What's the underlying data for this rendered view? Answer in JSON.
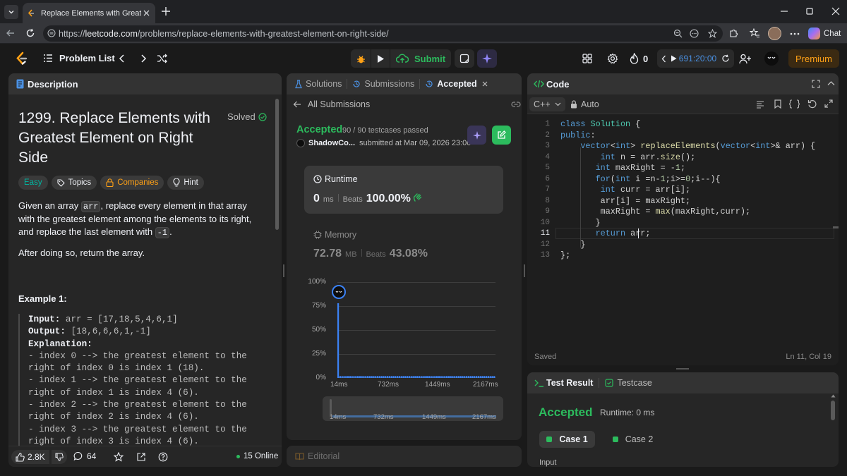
{
  "browser": {
    "tab_title": "Replace Elements with Greatest Ele",
    "url_prefix": "https://",
    "url_host": "leetcode.com",
    "url_path": "/problems/replace-elements-with-greatest-element-on-right-side/",
    "chat_label": "Chat"
  },
  "nav": {
    "problem_list": "Problem List",
    "submit": "Submit",
    "streak": "0",
    "timer": "691:20:00",
    "premium": "Premium"
  },
  "description": {
    "tab": "Description",
    "title": "1299. Replace Elements with Greatest Element on Right Side",
    "solved": "Solved",
    "tags": {
      "easy": "Easy",
      "topics": "Topics",
      "companies": "Companies",
      "hint": "Hint"
    },
    "p1_a": "Given an array ",
    "p1_code1": "arr",
    "p1_b": ", replace every element in that array with the greatest element among the elements to its right, and replace the last element with ",
    "p1_code2": "-1",
    "p1_c": ".",
    "p2": "After doing so, return the array.",
    "example_title": "Example 1:",
    "input_label": "Input:",
    "input_value": "arr = [17,18,5,4,6,1]",
    "output_label": "Output:",
    "output_value": "[18,6,6,6,1,-1]",
    "explanation_label": "Explanation:",
    "explanation_lines": [
      "- index 0 --> the greatest element to the",
      "right of index 0 is index 1 (18).",
      "- index 1 --> the greatest element to the",
      "right of index 1 is index 4 (6).",
      "- index 2 --> the greatest element to the",
      "right of index 2 is index 4 (6).",
      "- index 3 --> the greatest element to the",
      "right of index 3 is index 4 (6)."
    ],
    "likes": "2.8K",
    "comments": "64",
    "online": "15 Online"
  },
  "submission": {
    "tabs": {
      "solutions": "Solutions",
      "submissions": "Submissions",
      "accepted": "Accepted"
    },
    "back": "All Submissions",
    "status": "Accepted",
    "testcases": "90 / 90 testcases passed",
    "user": "ShadowCo...",
    "submitted_at": "submitted at Mar 09, 2026 23:00",
    "runtime_label": "Runtime",
    "runtime_value": "0",
    "runtime_unit": "ms",
    "beats_label": "Beats",
    "runtime_beats": "100.00%",
    "memory_label": "Memory",
    "memory_value": "72.78",
    "memory_unit": "MB",
    "memory_beats": "43.08%",
    "editorial": "Editorial"
  },
  "chart_data": {
    "type": "bar",
    "yticks": [
      "100%",
      "75%",
      "50%",
      "25%",
      "0%"
    ],
    "xticks": [
      "14ms",
      "732ms",
      "1449ms",
      "2167ms"
    ],
    "ylim": [
      0,
      100
    ],
    "values": [
      78,
      2,
      2,
      2,
      2,
      2,
      2,
      2,
      2,
      2,
      2,
      2,
      2,
      2,
      2,
      2,
      2,
      2,
      2,
      2,
      2,
      2,
      2,
      2,
      2,
      2,
      2,
      2,
      2,
      2,
      2,
      2,
      2,
      2,
      2,
      2,
      2,
      2,
      2,
      2,
      2,
      2,
      2,
      2,
      2,
      2,
      2,
      2,
      2,
      2,
      2,
      2,
      2,
      2,
      2,
      2,
      2,
      2,
      2,
      2,
      2,
      2,
      2,
      2,
      2,
      2,
      2,
      2,
      2,
      2,
      2,
      2,
      2,
      2,
      2,
      2,
      2,
      2,
      2,
      2
    ],
    "bar_color": "#3b82f6",
    "grid": true
  },
  "code": {
    "tab": "Code",
    "language": "C++",
    "mode": "Auto",
    "lines": [
      "class Solution {",
      "public:",
      "    vector<int> replaceElements(vector<int>& arr) {",
      "        int n = arr.size();",
      "       int maxRight = -1;",
      "       for(int i =n-1;i>=0;i--){",
      "        int curr = arr[i];",
      "        arr[i] = maxRight;",
      "        maxRight = max(maxRight,curr);",
      "       }",
      "       return arr;",
      "    }",
      "};"
    ],
    "saved": "Saved",
    "position": "Ln 11, Col 19"
  },
  "result": {
    "tab": "Test Result",
    "testcase_tab": "Testcase",
    "status": "Accepted",
    "runtime": "Runtime: 0 ms",
    "case1": "Case 1",
    "case2": "Case 2",
    "input": "Input"
  },
  "colors": {
    "accent": "#ffa116",
    "accepted": "#2cbb5d",
    "easy": "#00b8a3",
    "bar": "#3b82f6"
  }
}
